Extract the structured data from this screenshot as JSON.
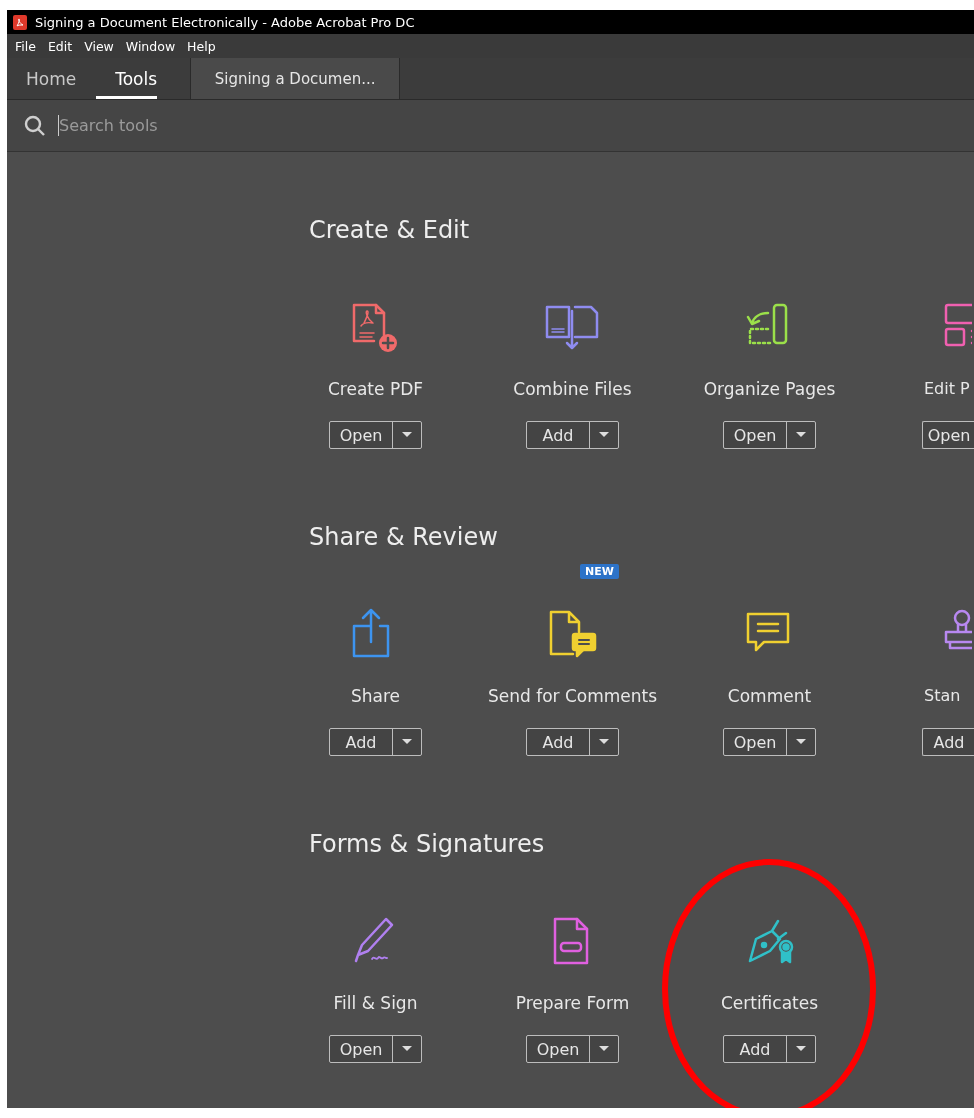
{
  "window": {
    "title": "Signing a Document Electronically - Adobe Acrobat Pro DC"
  },
  "menu": [
    "File",
    "Edit",
    "View",
    "Window",
    "Help"
  ],
  "tabs": [
    {
      "label": "Home",
      "selected": false
    },
    {
      "label": "Tools",
      "selected": true
    }
  ],
  "document_tab": {
    "label": "Signing a Documen..."
  },
  "search": {
    "placeholder": "Search tools"
  },
  "sections": [
    {
      "title": "Create & Edit",
      "tools": [
        {
          "name": "Create PDF",
          "action": "Open",
          "kind": "full"
        },
        {
          "name": "Combine Files",
          "action": "Add",
          "kind": "full"
        },
        {
          "name": "Organize Pages",
          "action": "Open",
          "kind": "full"
        },
        {
          "name": "Edit P",
          "action": "Open",
          "kind": "partial"
        }
      ]
    },
    {
      "title": "Share & Review",
      "tools": [
        {
          "name": "Share",
          "action": "Add",
          "kind": "full"
        },
        {
          "name": "Send for Comments",
          "action": "Add",
          "kind": "full",
          "badge": "NEW"
        },
        {
          "name": "Comment",
          "action": "Open",
          "kind": "full"
        },
        {
          "name": "Stan",
          "action": "Add",
          "kind": "partial"
        }
      ]
    },
    {
      "title": "Forms & Signatures",
      "tools": [
        {
          "name": "Fill & Sign",
          "action": "Open",
          "kind": "full"
        },
        {
          "name": "Prepare Form",
          "action": "Open",
          "kind": "full"
        },
        {
          "name": "Certificates",
          "action": "Add",
          "kind": "full"
        }
      ]
    }
  ],
  "annotation": {
    "kind": "ellipse",
    "color": "#ff0000"
  }
}
